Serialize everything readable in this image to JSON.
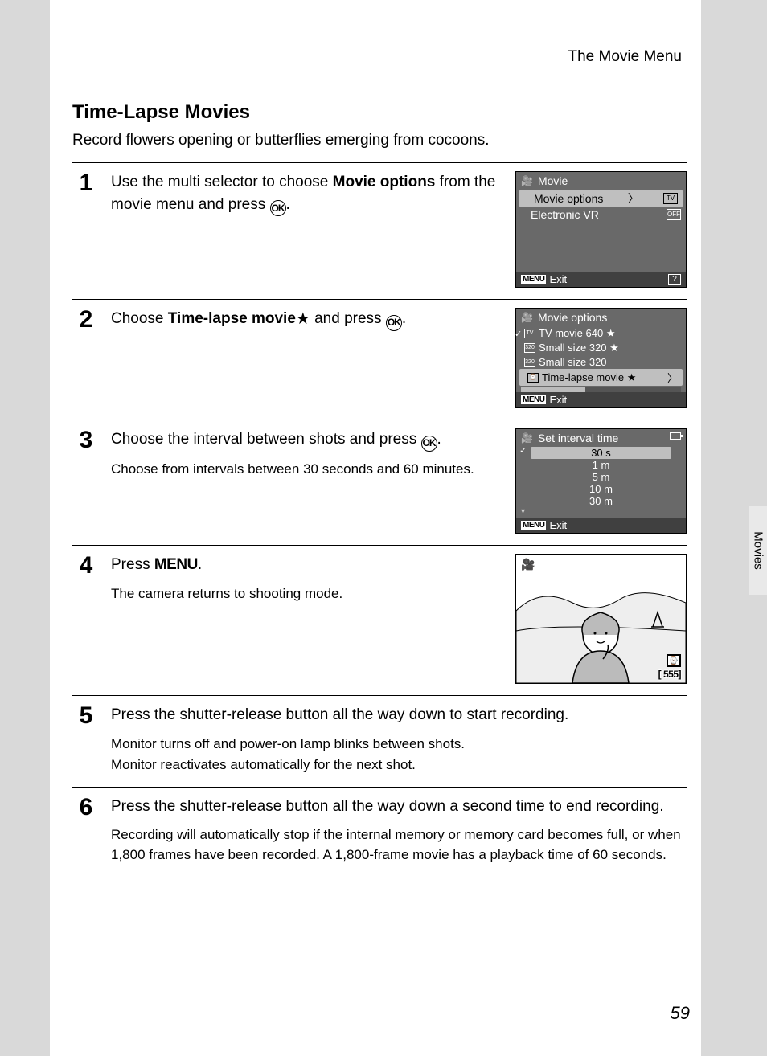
{
  "header": {
    "section": "The Movie Menu"
  },
  "title": "Time-Lapse Movies",
  "subtitle": "Record flowers opening or butterflies emerging from cocoons.",
  "side_tab": "Movies",
  "page_number": "59",
  "steps": {
    "s1": {
      "num": "1",
      "text_a": "Use the multi selector to choose ",
      "text_b1": "Movie options",
      "text_c": " from the movie menu and press ",
      "text_end": "."
    },
    "s2": {
      "num": "2",
      "text_a": "Choose ",
      "text_b": "Time-lapse movie",
      "text_c": " and press ",
      "text_end": "."
    },
    "s3": {
      "num": "3",
      "text_a": "Choose the interval between shots and press ",
      "text_end": ".",
      "sub": "Choose from intervals between 30 seconds and 60 minutes."
    },
    "s4": {
      "num": "4",
      "text_a": "Press ",
      "text_menu": "MENU",
      "text_end": ".",
      "sub": "The camera returns to shooting mode."
    },
    "s5": {
      "num": "5",
      "text_a": "Press the shutter-release button all the way down to start recording.",
      "sub1": "Monitor turns off and power-on lamp blinks between shots.",
      "sub2": "Monitor reactivates automatically for the next shot."
    },
    "s6": {
      "num": "6",
      "text_a": "Press the shutter-release button all the way down a second time to end recording.",
      "sub": "Recording will automatically stop if the internal memory or memory card becomes full, or when 1,800 frames have been recorded. A 1,800-frame movie has a playback time of 60 seconds."
    }
  },
  "lcd1": {
    "title": "Movie",
    "row1": "Movie options",
    "row2": "Electronic VR",
    "badge1": "TV",
    "badge2": "OFF",
    "exit": "Exit",
    "menu": "MENU",
    "q": "?"
  },
  "lcd2": {
    "title": "Movie options",
    "r1": "TV movie 640 ★",
    "r2": "Small size 320 ★",
    "r3": "Small size 320",
    "r4": "Time-lapse movie ★",
    "exit": "Exit",
    "menu": "MENU"
  },
  "lcd3": {
    "title": "Set interval time",
    "i1": "30 s",
    "i2": "1 m",
    "i3": "5 m",
    "i4": "10 m",
    "i5": "30 m",
    "exit": "Exit",
    "menu": "MENU"
  },
  "lcd4": {
    "counter": "[  555]"
  },
  "ok_label": "OK",
  "star": "★"
}
